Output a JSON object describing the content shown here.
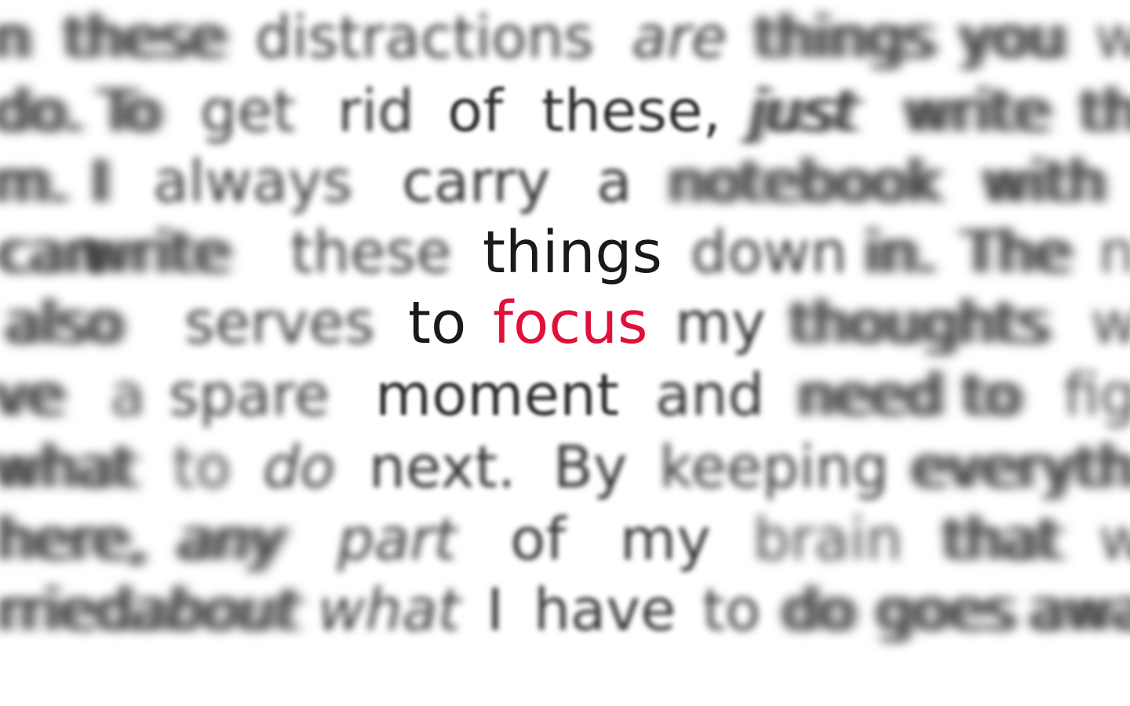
{
  "lines": [
    {
      "words": [
        "n",
        "these",
        "distractions",
        "are",
        "things",
        "you",
        "wi"
      ]
    },
    {
      "words": [
        "do.",
        "To",
        "get",
        "rid",
        "of",
        "these,",
        "just",
        "write",
        "th"
      ]
    },
    {
      "words": [
        "m.",
        "I",
        "always",
        "carry",
        "a",
        "notebook",
        "with"
      ]
    },
    {
      "words": [
        "can",
        "write",
        "these",
        "things",
        "down",
        "in.",
        "The",
        "n"
      ]
    },
    {
      "words": [
        "also",
        "serves",
        "to",
        "focus",
        "my",
        "thoughts",
        "w"
      ]
    },
    {
      "words": [
        "ve",
        "a",
        "spare",
        "moment",
        "and",
        "need",
        "to",
        "fig"
      ]
    },
    {
      "words": [
        "what",
        "to",
        "do",
        "next.",
        "By",
        "keeping",
        "everyth"
      ]
    },
    {
      "words": [
        "here,",
        "any",
        "part",
        "of",
        "my",
        "brain",
        "that",
        "w"
      ]
    },
    {
      "words": [
        "rried",
        "about",
        "what",
        "I",
        "have",
        "to",
        "do",
        "goes",
        "awa"
      ]
    }
  ],
  "highlight": {
    "word": "focus",
    "color": "#e0103a"
  }
}
